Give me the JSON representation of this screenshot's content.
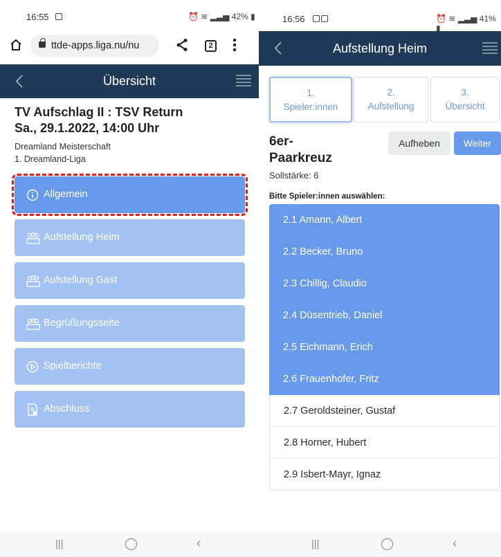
{
  "left": {
    "status": {
      "time": "16:55",
      "battery": "42%"
    },
    "browser": {
      "url": "ttde-apps.liga.nu/nu",
      "tab_count": "2"
    },
    "navbar": {
      "title": "Übersicht"
    },
    "match": {
      "title_line1": "TV Aufschlag II : TSV Return",
      "title_line2": "Sa., 29.1.2022, 14:00 Uhr",
      "championship": "Dreamland Meisterschaft",
      "league": "1. Dreamland-Liga"
    },
    "menu": [
      {
        "label": "Allgemein",
        "icon": "info-icon",
        "active": true
      },
      {
        "label": "Aufstellung Heim",
        "icon": "team-icon"
      },
      {
        "label": "Aufstellung Gast",
        "icon": "team-icon"
      },
      {
        "label": "Begrüßungsseite",
        "icon": "team-icon"
      },
      {
        "label": "Spielberichte",
        "icon": "play-icon"
      },
      {
        "label": "Abschluss",
        "icon": "report-icon"
      }
    ]
  },
  "right": {
    "status": {
      "time": "16:56",
      "battery": "41%"
    },
    "navbar": {
      "title": "Aufstellung Heim"
    },
    "steps": [
      {
        "num": "1.",
        "label": "Spieler:innen",
        "active": true
      },
      {
        "num": "2.",
        "label": "Aufstellung"
      },
      {
        "num": "3.",
        "label": "Übersicht"
      }
    ],
    "heading_line1": "6er-",
    "heading_line2": "Paarkreuz",
    "buttons": {
      "cancel": "Aufheben",
      "next": "Weiter"
    },
    "sollstaerke": "Sollstärke: 6",
    "instruction": "Bitte Spieler:innen auswählen:",
    "players": [
      {
        "name": "2.1 Amann, Albert",
        "selected": true
      },
      {
        "name": "2.2 Becker, Bruno",
        "selected": true
      },
      {
        "name": "2.3 Chillig, Claudio",
        "selected": true
      },
      {
        "name": "2.4 Düsentrieb, Daniel",
        "selected": true
      },
      {
        "name": "2.5 Eichmann, Erich",
        "selected": true
      },
      {
        "name": "2.6 Frauenhofer, Fritz",
        "selected": true
      },
      {
        "name": "2.7 Geroldsteiner, Gustaf",
        "selected": false
      },
      {
        "name": "2.8 Horner, Hubert",
        "selected": false
      },
      {
        "name": "2.9 Isbert-Mayr, Ignaz",
        "selected": false
      }
    ]
  },
  "colors": {
    "navbar": "#1e3a56",
    "primary": "#6699ea",
    "primary_light": "#a2c2f4",
    "highlight": "#e31a1a"
  }
}
